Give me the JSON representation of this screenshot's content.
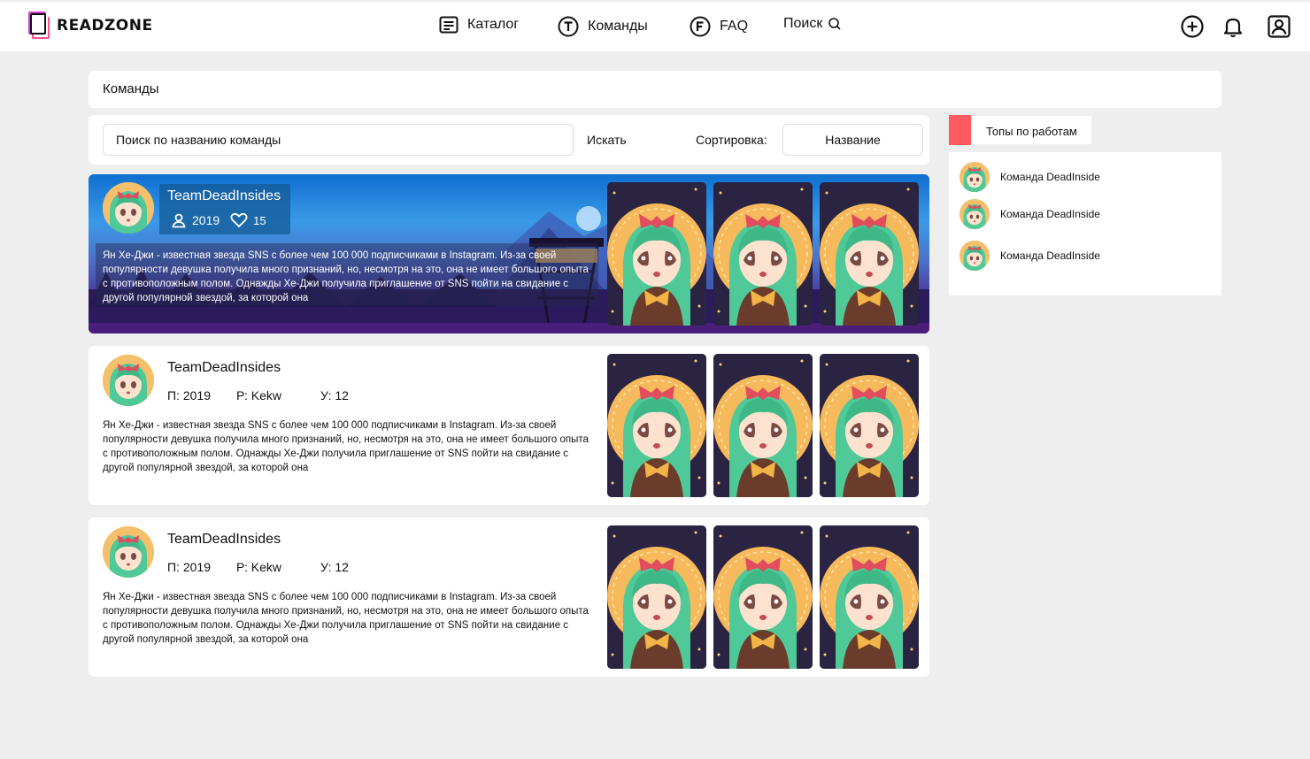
{
  "header": {
    "logo_text": "READZONE",
    "nav": [
      {
        "label": "Каталог",
        "icon": "catalog-icon"
      },
      {
        "label": "Команды",
        "icon": "teams-icon"
      },
      {
        "label": "FAQ",
        "icon": "faq-icon"
      },
      {
        "label": "Поиск",
        "icon": "search-icon"
      }
    ],
    "icons": [
      "add-icon",
      "bell-icon",
      "profile-icon"
    ]
  },
  "title": "Команды",
  "search": {
    "placeholder": "Поиск по названию команды",
    "button_label": "Искать",
    "sort_label": "Сортировка:",
    "sort_value": "Название"
  },
  "featured": {
    "name": "TeamDeadInsides",
    "members": "2019",
    "likes": "15",
    "description": "Ян Хе-Джи - известная звезда SNS с более чем 100 000 подписчиками в Instagram. Из-за своей популярности девушка получила много признаний, но, несмотря на это, она не имеет большого опыта с противоположным полом. Однажды Хе-Джи получила приглашение от SNS пойти на свидание с другой популярной звездой, за которой она"
  },
  "teams": [
    {
      "name": "TeamDeadInsides",
      "stat_p": "П: 2019",
      "stat_r": "Р: Kekw",
      "stat_u": "У: 12",
      "description": "Ян Хе-Джи - известная звезда SNS с более чем 100 000 подписчиками в Instagram. Из-за своей популярности девушка получила много признаний, но, несмотря на это, она не имеет большого опыта с противоположным полом. Однажды Хе-Джи получила приглашение от SNS пойти на свидание с другой популярной звездой, за которой она"
    },
    {
      "name": "TeamDeadInsides",
      "stat_p": "П: 2019",
      "stat_r": "Р: Kekw",
      "stat_u": "У: 12",
      "description": "Ян Хе-Джи - известная звезда SNS с более чем 100 000 подписчиками в Instagram. Из-за своей популярности девушка получила много признаний, но, несмотря на это, она не имеет большого опыта с противоположным полом. Однажды Хе-Джи получила приглашение от SNS пойти на свидание с другой популярной звездой, за которой она"
    }
  ],
  "sidebar": {
    "tab_label": "Топы по работам",
    "accent": "#ff5a5f",
    "items": [
      {
        "label": "Команда DeadInside"
      },
      {
        "label": "Команда DeadInside"
      },
      {
        "label": "Команда DeadInside"
      }
    ]
  },
  "colors": {
    "brand_pink": "#ff4d8d",
    "brand_purple": "#d63ad8",
    "hair_green": "#4fc998",
    "halo_orange": "#f6b95c"
  }
}
